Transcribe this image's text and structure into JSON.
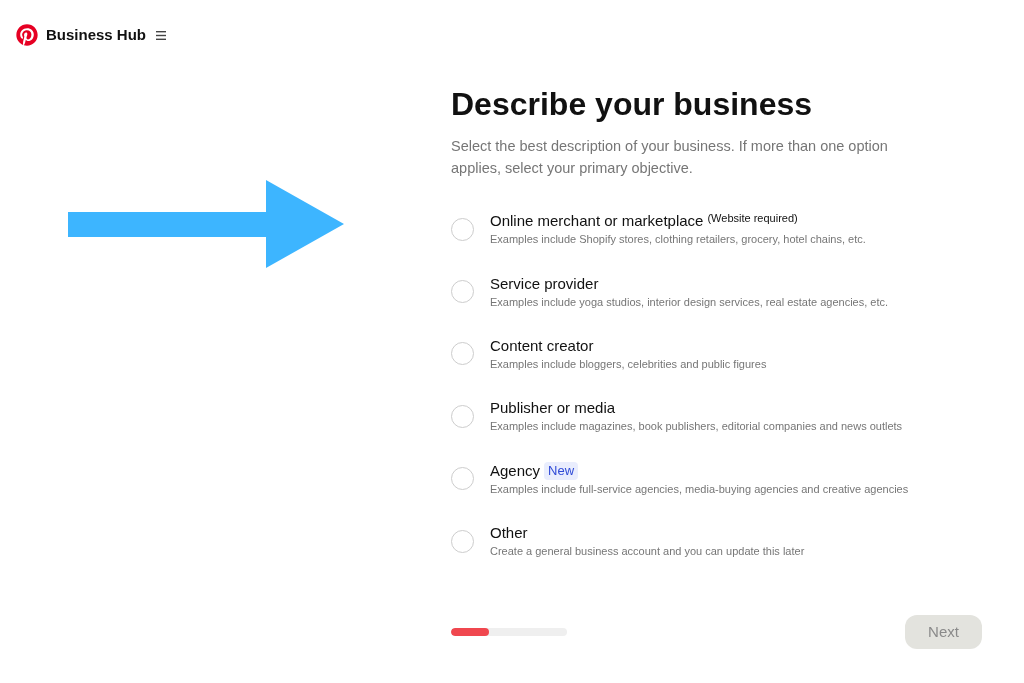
{
  "header": {
    "title": "Business Hub"
  },
  "page": {
    "heading": "Describe your business",
    "description": "Select the best description of your business. If more than one option applies, select your primary objective."
  },
  "options": [
    {
      "label": "Online merchant or marketplace",
      "note": "(Website required)",
      "description": "Examples include Shopify stores, clothing retailers, grocery, hotel chains, etc.",
      "selected": false
    },
    {
      "label": "Service provider",
      "description": "Examples include yoga studios, interior design services, real estate agencies, etc.",
      "selected": false
    },
    {
      "label": "Content creator",
      "description": "Examples include bloggers, celebrities and public figures",
      "selected": false
    },
    {
      "label": "Publisher or media",
      "description": "Examples include magazines, book publishers, editorial companies and news outlets",
      "selected": false
    },
    {
      "label": "Agency",
      "badge": "New",
      "description": "Examples include full-service agencies, media-buying agencies and creative agencies",
      "selected": false
    },
    {
      "label": "Other",
      "description": "Create a general business account and you can update this later",
      "selected": false
    }
  ],
  "progress": {
    "level": 0.33
  },
  "next_button": {
    "label": "Next",
    "disabled": true
  }
}
